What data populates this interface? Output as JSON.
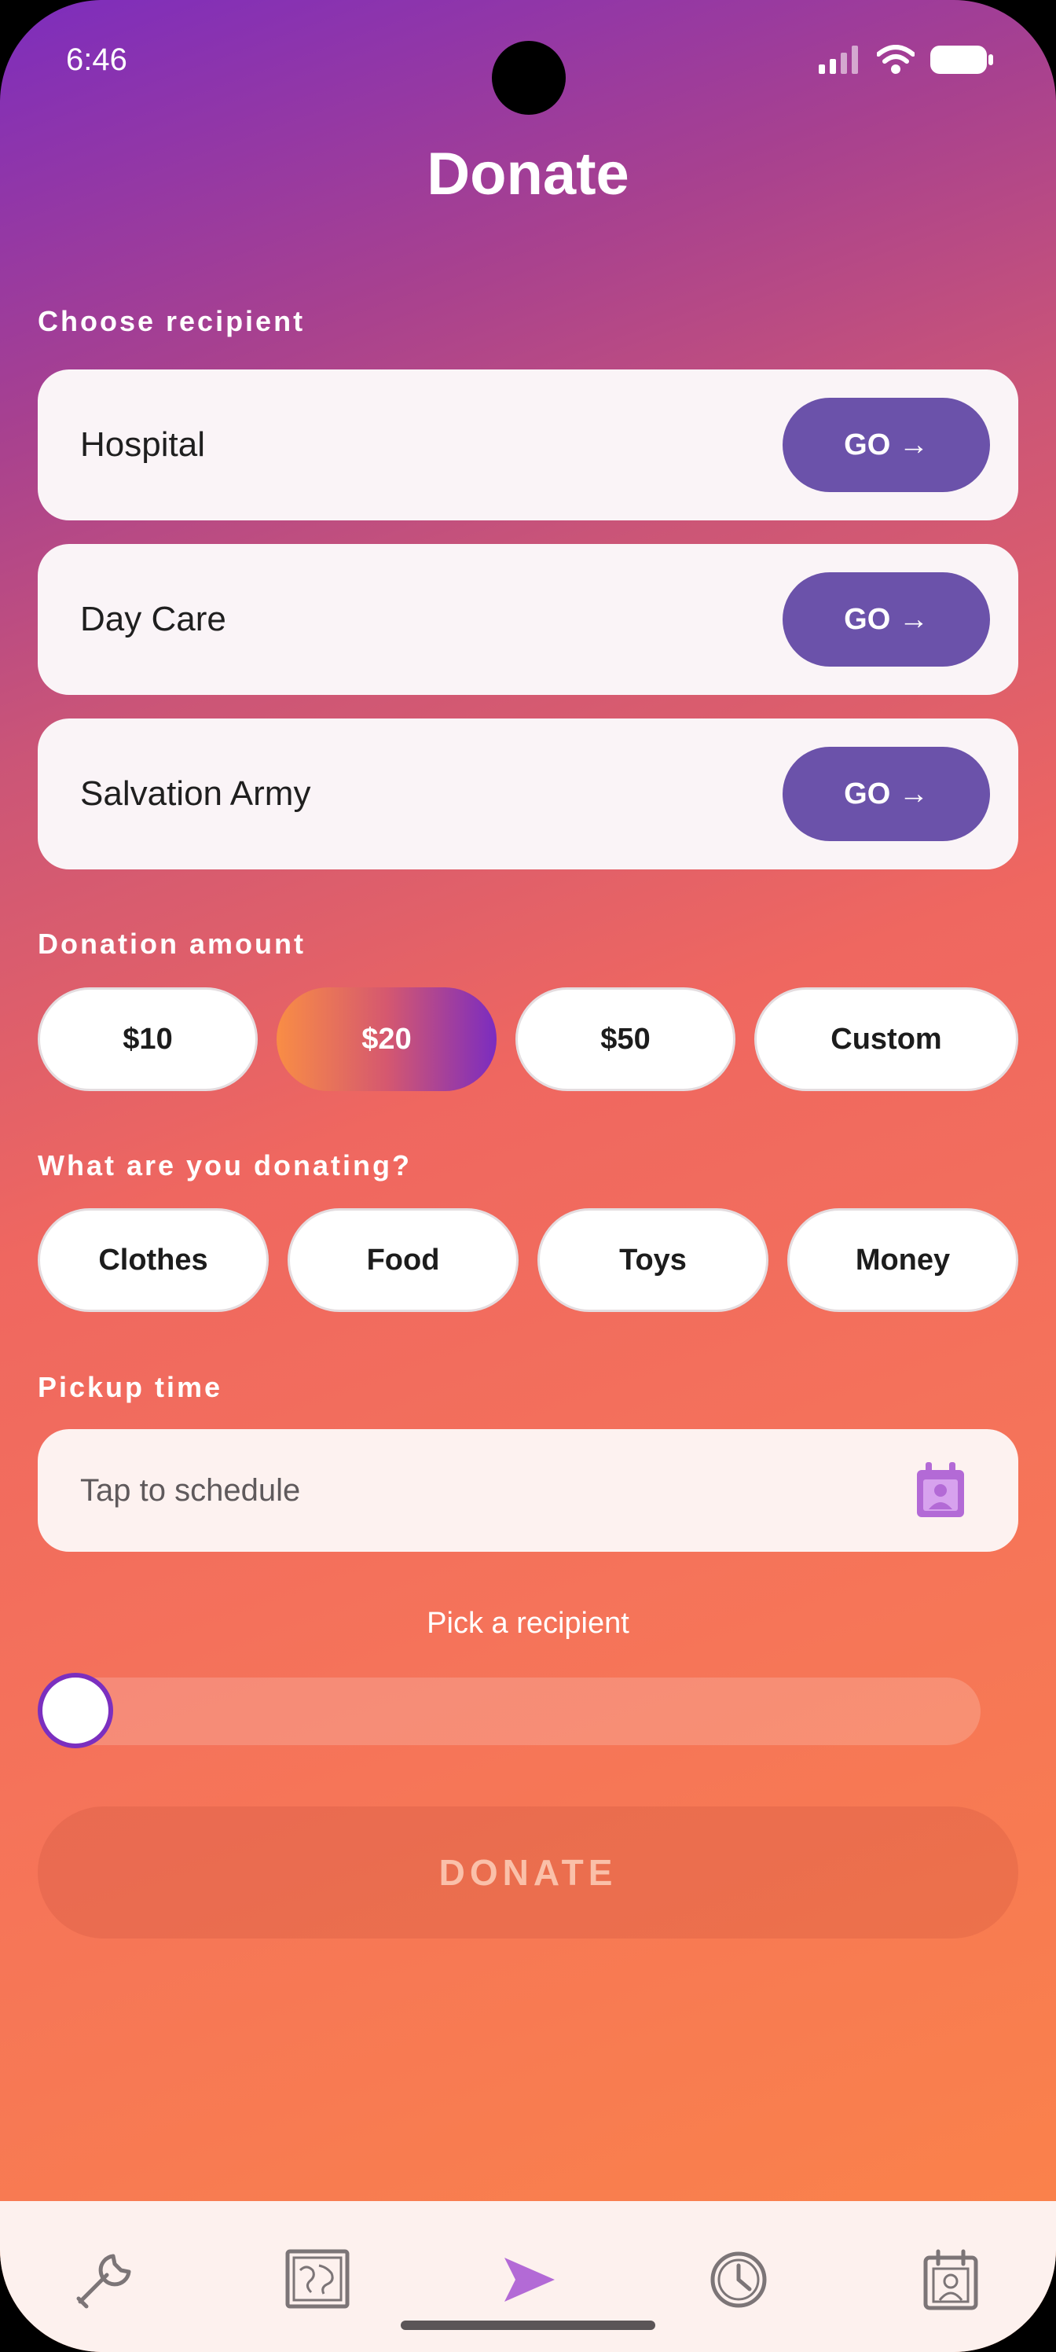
{
  "status_bar": {
    "time": "6:46"
  },
  "page_title": "Donate",
  "recipients": {
    "label": "Choose recipient",
    "items": [
      {
        "name": "Hospital",
        "action": "GO →"
      },
      {
        "name": "Day Care",
        "action": "GO →"
      },
      {
        "name": "Salvation Army",
        "action": "GO →"
      }
    ]
  },
  "amount": {
    "label": "Donation amount",
    "options": [
      "$10",
      "$20",
      "$50",
      "Custom"
    ],
    "selected": "$20"
  },
  "donation_type": {
    "label": "What are you donating?",
    "options": [
      "Clothes",
      "Food",
      "Toys",
      "Money"
    ]
  },
  "pickup": {
    "label": "Pickup time",
    "placeholder": "Tap to schedule"
  },
  "slider": {
    "hint": "Pick a recipient",
    "value": 0
  },
  "donate_button": {
    "label": "DONATE",
    "enabled": false
  },
  "bottom_nav": {
    "items": [
      "wrench-icon",
      "map-icon",
      "send-icon",
      "clock-icon",
      "calendar-contact-icon"
    ],
    "active": "send-icon"
  },
  "colors": {
    "accent": "#6b52aa",
    "gradient_top": "#7d2dbd",
    "gradient_bottom": "#fb8448"
  }
}
